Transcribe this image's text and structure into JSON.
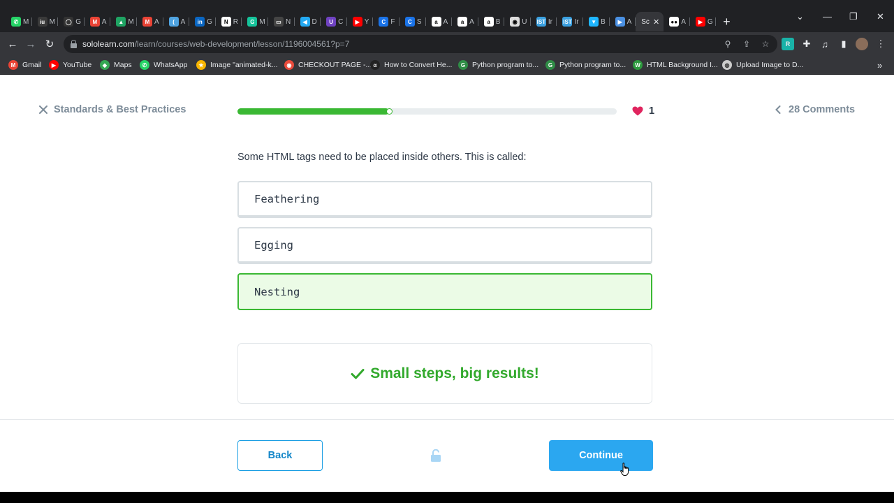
{
  "browser": {
    "tabs": [
      {
        "letter": "M",
        "color": "#25d366",
        "glyph": "✆"
      },
      {
        "letter": "M",
        "color": "#3a3a3a",
        "glyph": "iu"
      },
      {
        "letter": "G",
        "color": "#333333",
        "glyph": "◯"
      },
      {
        "letter": "A",
        "color": "#ea4335",
        "glyph": "M"
      },
      {
        "letter": "M",
        "color": "#1fa463",
        "glyph": "▲"
      },
      {
        "letter": "A",
        "color": "#ea4335",
        "glyph": "M"
      },
      {
        "letter": "A",
        "color": "#4fa3e0",
        "glyph": "("
      },
      {
        "letter": "G",
        "color": "#0a66c2",
        "glyph": "in"
      },
      {
        "letter": "R",
        "color": "#ffffff",
        "glyph": "N"
      },
      {
        "letter": "M",
        "color": "#15c39a",
        "glyph": "G"
      },
      {
        "letter": "N",
        "color": "#444444",
        "glyph": "▭"
      },
      {
        "letter": "D",
        "color": "#23a9f2",
        "glyph": "◀"
      },
      {
        "letter": "C",
        "color": "#6f42c1",
        "glyph": "U"
      },
      {
        "letter": "Y",
        "color": "#ff0000",
        "glyph": "▶"
      },
      {
        "letter": "F",
        "color": "#1a73e8",
        "glyph": "C"
      },
      {
        "letter": "S",
        "color": "#1a73e8",
        "glyph": "C"
      },
      {
        "letter": "A",
        "color": "#ffffff",
        "glyph": "a"
      },
      {
        "letter": "A",
        "color": "#ffffff",
        "glyph": "a"
      },
      {
        "letter": "B",
        "color": "#ffffff",
        "glyph": "a"
      },
      {
        "letter": "U",
        "color": "#dddddd",
        "glyph": "◉"
      },
      {
        "letter": "Ir",
        "color": "#3aa0e0",
        "glyph": "IST"
      },
      {
        "letter": "Ir",
        "color": "#3aa0e0",
        "glyph": "IST"
      },
      {
        "letter": "B",
        "color": "#1fb6ff",
        "glyph": "▼"
      },
      {
        "letter": "A",
        "color": "#4a90e2",
        "glyph": "▶"
      }
    ],
    "active_tab": {
      "letter": "Sc",
      "close": "✕"
    },
    "tabs_after": [
      {
        "letter": "A",
        "color": "#ffffff",
        "glyph": "●●"
      },
      {
        "letter": "G",
        "color": "#ff0000",
        "glyph": "▶"
      }
    ],
    "new_tab": "+",
    "url_host": "sololearn.com",
    "url_path": "/learn/courses/web-development/lesson/1196004561?p=7",
    "bookmarks": [
      {
        "label": "Gmail",
        "color": "#ea4335",
        "glyph": "M"
      },
      {
        "label": "YouTube",
        "color": "#ff0000",
        "glyph": "▶"
      },
      {
        "label": "Maps",
        "color": "#34a853",
        "glyph": "◆"
      },
      {
        "label": "WhatsApp",
        "color": "#25d366",
        "glyph": "✆"
      },
      {
        "label": "Image \"animated-k...",
        "color": "#f7b500",
        "glyph": "★"
      },
      {
        "label": "CHECKOUT PAGE -...",
        "color": "#e94b3c",
        "glyph": "◉"
      },
      {
        "label": "How to Convert He...",
        "color": "#222222",
        "glyph": "α"
      },
      {
        "label": "Python program to...",
        "color": "#2f8d46",
        "glyph": "G"
      },
      {
        "label": "Python program to...",
        "color": "#2f8d46",
        "glyph": "G"
      },
      {
        "label": "HTML Background I...",
        "color": "#2e9b3f",
        "glyph": "W"
      },
      {
        "label": "Upload Image to D...",
        "color": "#cccccc",
        "glyph": "◍"
      }
    ],
    "bookmarks_more": "»"
  },
  "lesson": {
    "close_label": "Standards & Best Practices",
    "progress_fraction": 0.4,
    "hearts": "1",
    "comments_label": "28 Comments",
    "question": "Some HTML tags need to be placed inside others. This is called:",
    "options": [
      {
        "label": "Feathering",
        "selected": false
      },
      {
        "label": "Egging",
        "selected": false
      },
      {
        "label": "Nesting",
        "selected": true
      }
    ],
    "feedback": "Small steps, big results!",
    "back_label": "Back",
    "continue_label": "Continue"
  },
  "colors": {
    "accent_green": "#3ab833",
    "accent_blue": "#2ba7f0",
    "heart": "#e0245e"
  }
}
